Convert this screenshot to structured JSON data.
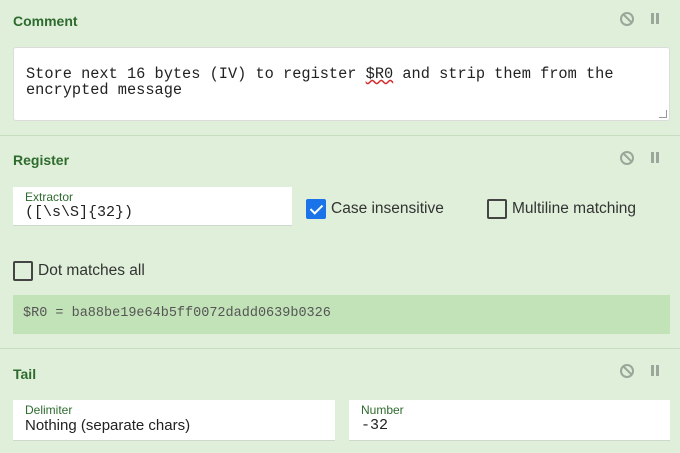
{
  "comment": {
    "title": "Comment",
    "text_line1": "Store next 16 bytes (IV) to register $R0 and strip them from the",
    "text_line2": "encrypted message",
    "text_pre": "Store next 16 bytes (IV) to register ",
    "text_reg": "$R0",
    "text_post": " and strip them from the"
  },
  "register": {
    "title": "Register",
    "extractor_label": "Extractor",
    "extractor_value": "([\\s\\S]{32})",
    "case_insensitive_label": "Case insensitive",
    "case_insensitive_checked": true,
    "multiline_label": "Multiline matching",
    "multiline_checked": false,
    "dotall_label": "Dot matches all",
    "dotall_checked": false,
    "output": "$R0 = ba88be19e64b5ff0072dadd0639b0326"
  },
  "tail": {
    "title": "Tail",
    "delimiter_label": "Delimiter",
    "delimiter_value": "Nothing (separate chars)",
    "number_label": "Number",
    "number_value": "-32"
  },
  "colors": {
    "background": "#dfefd9",
    "title": "#2e6b2e",
    "checkbox_checked": "#1a73e8",
    "output_bg": "#c2e3b8"
  }
}
